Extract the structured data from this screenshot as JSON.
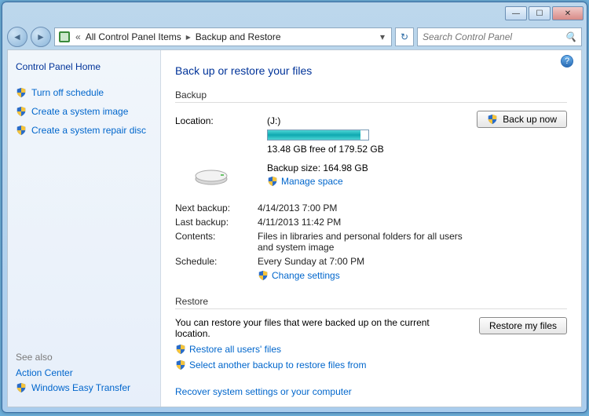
{
  "window": {
    "search_placeholder": "Search Control Panel"
  },
  "breadcrumb": {
    "item1": "All Control Panel Items",
    "item2": "Backup and Restore"
  },
  "sidebar": {
    "home": "Control Panel Home",
    "task1": "Turn off schedule",
    "task2": "Create a system image",
    "task3": "Create a system repair disc",
    "seealso_hdr": "See also",
    "seealso1": "Action Center",
    "seealso2": "Windows Easy Transfer"
  },
  "main": {
    "title": "Back up or restore your files",
    "backup_hdr": "Backup",
    "location_lbl": "Location:",
    "drive": "(J:)",
    "free_text": "13.48 GB free of 179.52 GB",
    "size_text": "Backup size: 164.98 GB",
    "manage_link": "Manage space",
    "backup_now_btn": "Back up now",
    "next_lbl": "Next backup:",
    "next_val": "4/14/2013 7:00 PM",
    "last_lbl": "Last backup:",
    "last_val": "4/11/2013 11:42 PM",
    "contents_lbl": "Contents:",
    "contents_val": "Files in libraries and personal folders for all users and system image",
    "schedule_lbl": "Schedule:",
    "schedule_val": "Every Sunday at 7:00 PM",
    "change_link": "Change settings",
    "restore_hdr": "Restore",
    "restore_text": "You can restore your files that were backed up on the current location.",
    "restore_btn": "Restore my files",
    "restore_all_link": "Restore all users' files",
    "select_another_link": "Select another backup to restore files from",
    "recover_link": "Recover system settings or your computer"
  }
}
